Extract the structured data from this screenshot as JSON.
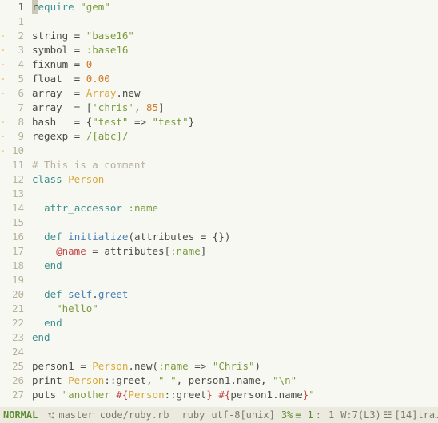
{
  "lines": [
    {
      "n": 1,
      "current": true,
      "mark": "",
      "tokens": [
        [
          "cursor",
          "r"
        ],
        [
          "kw",
          "equire "
        ],
        [
          "str",
          "\"gem\""
        ]
      ]
    },
    {
      "n": 1,
      "current": false,
      "mark": "",
      "tokens": []
    },
    {
      "n": 2,
      "current": false,
      "mark": "--",
      "tokens": [
        [
          "id",
          "string = "
        ],
        [
          "str",
          "\"base16\""
        ]
      ]
    },
    {
      "n": 3,
      "current": false,
      "mark": "--",
      "tokens": [
        [
          "id",
          "symbol = "
        ],
        [
          "sym",
          ":base16"
        ]
      ]
    },
    {
      "n": 4,
      "current": false,
      "mark": "--",
      "tokens": [
        [
          "id",
          "fixnum = "
        ],
        [
          "num",
          "0"
        ]
      ]
    },
    {
      "n": 5,
      "current": false,
      "mark": "--",
      "tokens": [
        [
          "id",
          "float  = "
        ],
        [
          "num",
          "0.00"
        ]
      ]
    },
    {
      "n": 6,
      "current": false,
      "mark": "",
      "tokens": [
        [
          "id",
          "array  = "
        ],
        [
          "const",
          "Array"
        ],
        [
          "id",
          ".new"
        ]
      ]
    },
    {
      "n": 7,
      "current": false,
      "mark": "",
      "tokens": [
        [
          "id",
          "array  = ["
        ],
        [
          "str",
          "'chris'"
        ],
        [
          "id",
          ", "
        ],
        [
          "num",
          "85"
        ],
        [
          "id",
          "]"
        ]
      ]
    },
    {
      "n": 8,
      "current": false,
      "mark": "--",
      "tokens": [
        [
          "id",
          "hash   = {"
        ],
        [
          "str",
          "\"test\""
        ],
        [
          "id",
          " => "
        ],
        [
          "str",
          "\"test\""
        ],
        [
          "id",
          "}"
        ]
      ]
    },
    {
      "n": 9,
      "current": false,
      "mark": "--",
      "tokens": [
        [
          "id",
          "regexp = "
        ],
        [
          "regex",
          "/[abc]/"
        ]
      ]
    },
    {
      "n": 10,
      "current": false,
      "mark": "",
      "tokens": []
    },
    {
      "n": 11,
      "current": false,
      "mark": "",
      "tokens": [
        [
          "cmt",
          "# This is a comment"
        ]
      ]
    },
    {
      "n": 12,
      "current": false,
      "mark": "",
      "tokens": [
        [
          "kw",
          "class "
        ],
        [
          "const",
          "Person"
        ]
      ]
    },
    {
      "n": 13,
      "current": false,
      "mark": "",
      "tokens": []
    },
    {
      "n": 14,
      "current": false,
      "mark": "",
      "tokens": [
        [
          "id",
          "  "
        ],
        [
          "kw",
          "attr_accessor "
        ],
        [
          "sym",
          ":name"
        ]
      ]
    },
    {
      "n": 15,
      "current": false,
      "mark": "",
      "tokens": []
    },
    {
      "n": 16,
      "current": false,
      "mark": "",
      "tokens": [
        [
          "id",
          "  "
        ],
        [
          "kw",
          "def "
        ],
        [
          "blue",
          "initialize"
        ],
        [
          "id",
          "(attributes = {})"
        ]
      ]
    },
    {
      "n": 17,
      "current": false,
      "mark": "",
      "tokens": [
        [
          "id",
          "    "
        ],
        [
          "var",
          "@name"
        ],
        [
          "id",
          " = attributes["
        ],
        [
          "sym",
          ":name"
        ],
        [
          "id",
          "]"
        ]
      ]
    },
    {
      "n": 18,
      "current": false,
      "mark": "",
      "tokens": [
        [
          "id",
          "  "
        ],
        [
          "kw",
          "end"
        ]
      ]
    },
    {
      "n": 19,
      "current": false,
      "mark": "",
      "tokens": []
    },
    {
      "n": 20,
      "current": false,
      "mark": "",
      "tokens": [
        [
          "id",
          "  "
        ],
        [
          "kw",
          "def "
        ],
        [
          "blue",
          "self"
        ],
        [
          "id",
          "."
        ],
        [
          "blue",
          "greet"
        ]
      ]
    },
    {
      "n": 21,
      "current": false,
      "mark": "",
      "tokens": [
        [
          "id",
          "    "
        ],
        [
          "str",
          "\"hello\""
        ]
      ]
    },
    {
      "n": 22,
      "current": false,
      "mark": "",
      "tokens": [
        [
          "id",
          "  "
        ],
        [
          "kw",
          "end"
        ]
      ]
    },
    {
      "n": 23,
      "current": false,
      "mark": "",
      "tokens": [
        [
          "kw",
          "end"
        ]
      ]
    },
    {
      "n": 24,
      "current": false,
      "mark": "",
      "tokens": []
    },
    {
      "n": 25,
      "current": false,
      "mark": "",
      "tokens": [
        [
          "id",
          "person1 = "
        ],
        [
          "const",
          "Person"
        ],
        [
          "id",
          ".new("
        ],
        [
          "sym",
          ":name"
        ],
        [
          "id",
          " => "
        ],
        [
          "str",
          "\"Chris\""
        ],
        [
          "id",
          ")"
        ]
      ]
    },
    {
      "n": 26,
      "current": false,
      "mark": "",
      "tokens": [
        [
          "id",
          "print "
        ],
        [
          "const",
          "Person"
        ],
        [
          "id",
          "::greet, "
        ],
        [
          "str",
          "\" \""
        ],
        [
          "id",
          ", person1.name, "
        ],
        [
          "str",
          "\"\\n\""
        ]
      ]
    },
    {
      "n": 27,
      "current": false,
      "mark": "",
      "tokens": [
        [
          "id",
          "puts "
        ],
        [
          "str",
          "\"another "
        ],
        [
          "interp",
          "#{"
        ],
        [
          "const",
          "Person"
        ],
        [
          "id",
          "::greet"
        ],
        [
          "interp",
          "}"
        ],
        [
          "str",
          " "
        ],
        [
          "interp",
          "#{"
        ],
        [
          "id",
          "person1.name"
        ],
        [
          "interp",
          "}"
        ],
        [
          "str",
          "\""
        ]
      ]
    }
  ],
  "tilde": "~",
  "status": {
    "mode": "NORMAL",
    "branch": "master",
    "path": "code/ruby.rb",
    "filetype": "ruby",
    "encoding": "utf-8[unix]",
    "percent": "3%",
    "linecol_line": "1",
    "linecol_sep": ":",
    "linecol_col": "1",
    "warnings": "W:7(L3)",
    "errors": "[14]tra…"
  }
}
